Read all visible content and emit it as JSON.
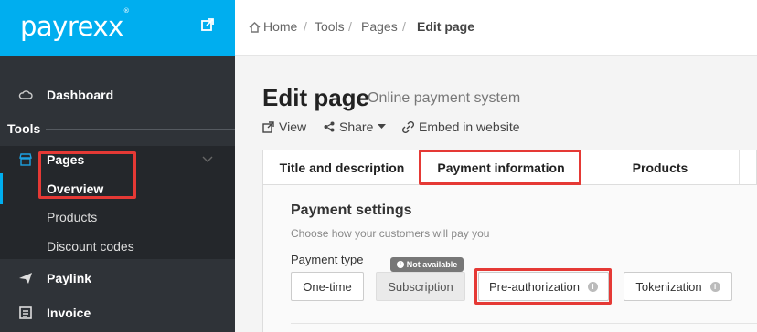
{
  "brand": {
    "logo_text": "payrexx",
    "logo_mark": "®",
    "color": "#00aeef"
  },
  "sidebar": {
    "dashboard_label": "Dashboard",
    "section_label": "Tools",
    "pages_label": "Pages",
    "sub_items": [
      "Overview",
      "Products",
      "Discount codes"
    ],
    "paylink_label": "Paylink",
    "invoice_label": "Invoice"
  },
  "breadcrumb": {
    "home": "Home",
    "tools": "Tools",
    "pages": "Pages",
    "current": "Edit page",
    "separator": "/"
  },
  "header": {
    "title": "Edit page",
    "subtitle": "Online payment system"
  },
  "actions": {
    "view": "View",
    "share": "Share",
    "embed": "Embed in website"
  },
  "tabs": [
    "Title and description",
    "Payment information",
    "Products"
  ],
  "payment": {
    "title": "Payment settings",
    "help": "Choose how your customers will pay you",
    "type_label": "Payment type",
    "badge": "Not available",
    "options": [
      "One-time",
      "Subscription",
      "Pre-authorization",
      "Tokenization"
    ]
  },
  "colors": {
    "sidebar": "#2f3338",
    "highlight": "#e53935"
  }
}
